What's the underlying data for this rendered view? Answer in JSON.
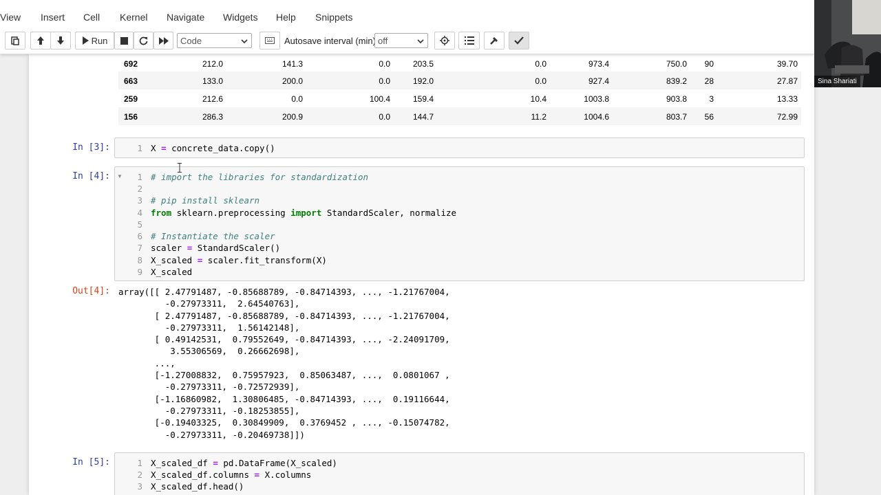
{
  "menu": [
    "View",
    "Insert",
    "Cell",
    "Kernel",
    "Navigate",
    "Widgets",
    "Help",
    "Snippets"
  ],
  "toolbar": {
    "run_label": "Run",
    "cell_type": "Code",
    "autosave_label": "Autosave interval (min):",
    "autosave_value": "off"
  },
  "table": {
    "rows": [
      [
        "692",
        "212.0",
        "141.3",
        "0.0",
        "203.5",
        "0.0",
        "973.4",
        "750.0",
        "90",
        "39.70"
      ],
      [
        "663",
        "133.0",
        "200.0",
        "0.0",
        "192.0",
        "0.0",
        "927.4",
        "839.2",
        "28",
        "27.87"
      ],
      [
        "259",
        "212.6",
        "0.0",
        "100.4",
        "159.4",
        "10.4",
        "1003.8",
        "903.8",
        "3",
        "13.33"
      ],
      [
        "156",
        "286.3",
        "200.9",
        "0.0",
        "144.7",
        "11.2",
        "1004.6",
        "803.7",
        "56",
        "72.99"
      ]
    ]
  },
  "cells": {
    "c3": {
      "prompt": "In [3]:",
      "line_numbers": [
        "1"
      ]
    },
    "c4": {
      "prompt": "In [4]:",
      "line_numbers": [
        "1",
        "2",
        "3",
        "4",
        "5",
        "6",
        "7",
        "8",
        "9"
      ],
      "out_prompt": "Out[4]:",
      "output": "array([[ 2.47791487, -0.85688789, -0.84714393, ..., -1.21767004,\n         -0.27973311,  2.64540763],\n       [ 2.47791487, -0.85688789, -0.84714393, ..., -1.21767004,\n         -0.27973311,  1.56142148],\n       [ 0.49142531,  0.79552649, -0.84714393, ..., -2.24091709,\n          3.55306569,  0.26662698],\n       ...,\n       [-1.27008832,  0.75957923,  0.85063487, ...,  0.0801067 ,\n         -0.27973311, -0.72572939],\n       [-1.16860982,  1.30806485, -0.84714393, ...,  0.19116644,\n         -0.27973311, -0.18253855],\n       [-0.19403325,  0.30849909,  0.3769452 , ..., -0.15074782,\n         -0.27973311, -0.20469738]])"
    },
    "c5": {
      "prompt": "In [5]:",
      "line_numbers": [
        "1",
        "2",
        "3"
      ]
    }
  },
  "code_text": {
    "c3_l1_a": "X ",
    "c3_l1_op": "=",
    "c3_l1_b": " concrete_data.copy()",
    "c4_l1": "# import the libraries for standardization",
    "c4_l3": "# pip install sklearn",
    "c4_l4_kw1": "from",
    "c4_l4_mid": " sklearn.preprocessing ",
    "c4_l4_kw2": "import",
    "c4_l4_end": " StandardScaler, normalize",
    "c4_l6": "# Instantiate the scaler",
    "c4_l7_a": "scaler ",
    "c4_l7_op": "=",
    "c4_l7_b": " StandardScaler()",
    "c4_l8_a": "X_scaled ",
    "c4_l8_op": "=",
    "c4_l8_b": " scaler.fit_transform(X)",
    "c4_l9": "X_scaled",
    "c5_l1_a": "X_scaled_df ",
    "c5_l1_op": "=",
    "c5_l1_b": " pd.DataFrame(X_scaled)",
    "c5_l2_a": "X_scaled_df.columns ",
    "c5_l2_op": "=",
    "c5_l2_b": " X.columns",
    "c5_l3": "X_scaled_df.head()"
  },
  "webcam": {
    "name": "Sina Shariati"
  }
}
